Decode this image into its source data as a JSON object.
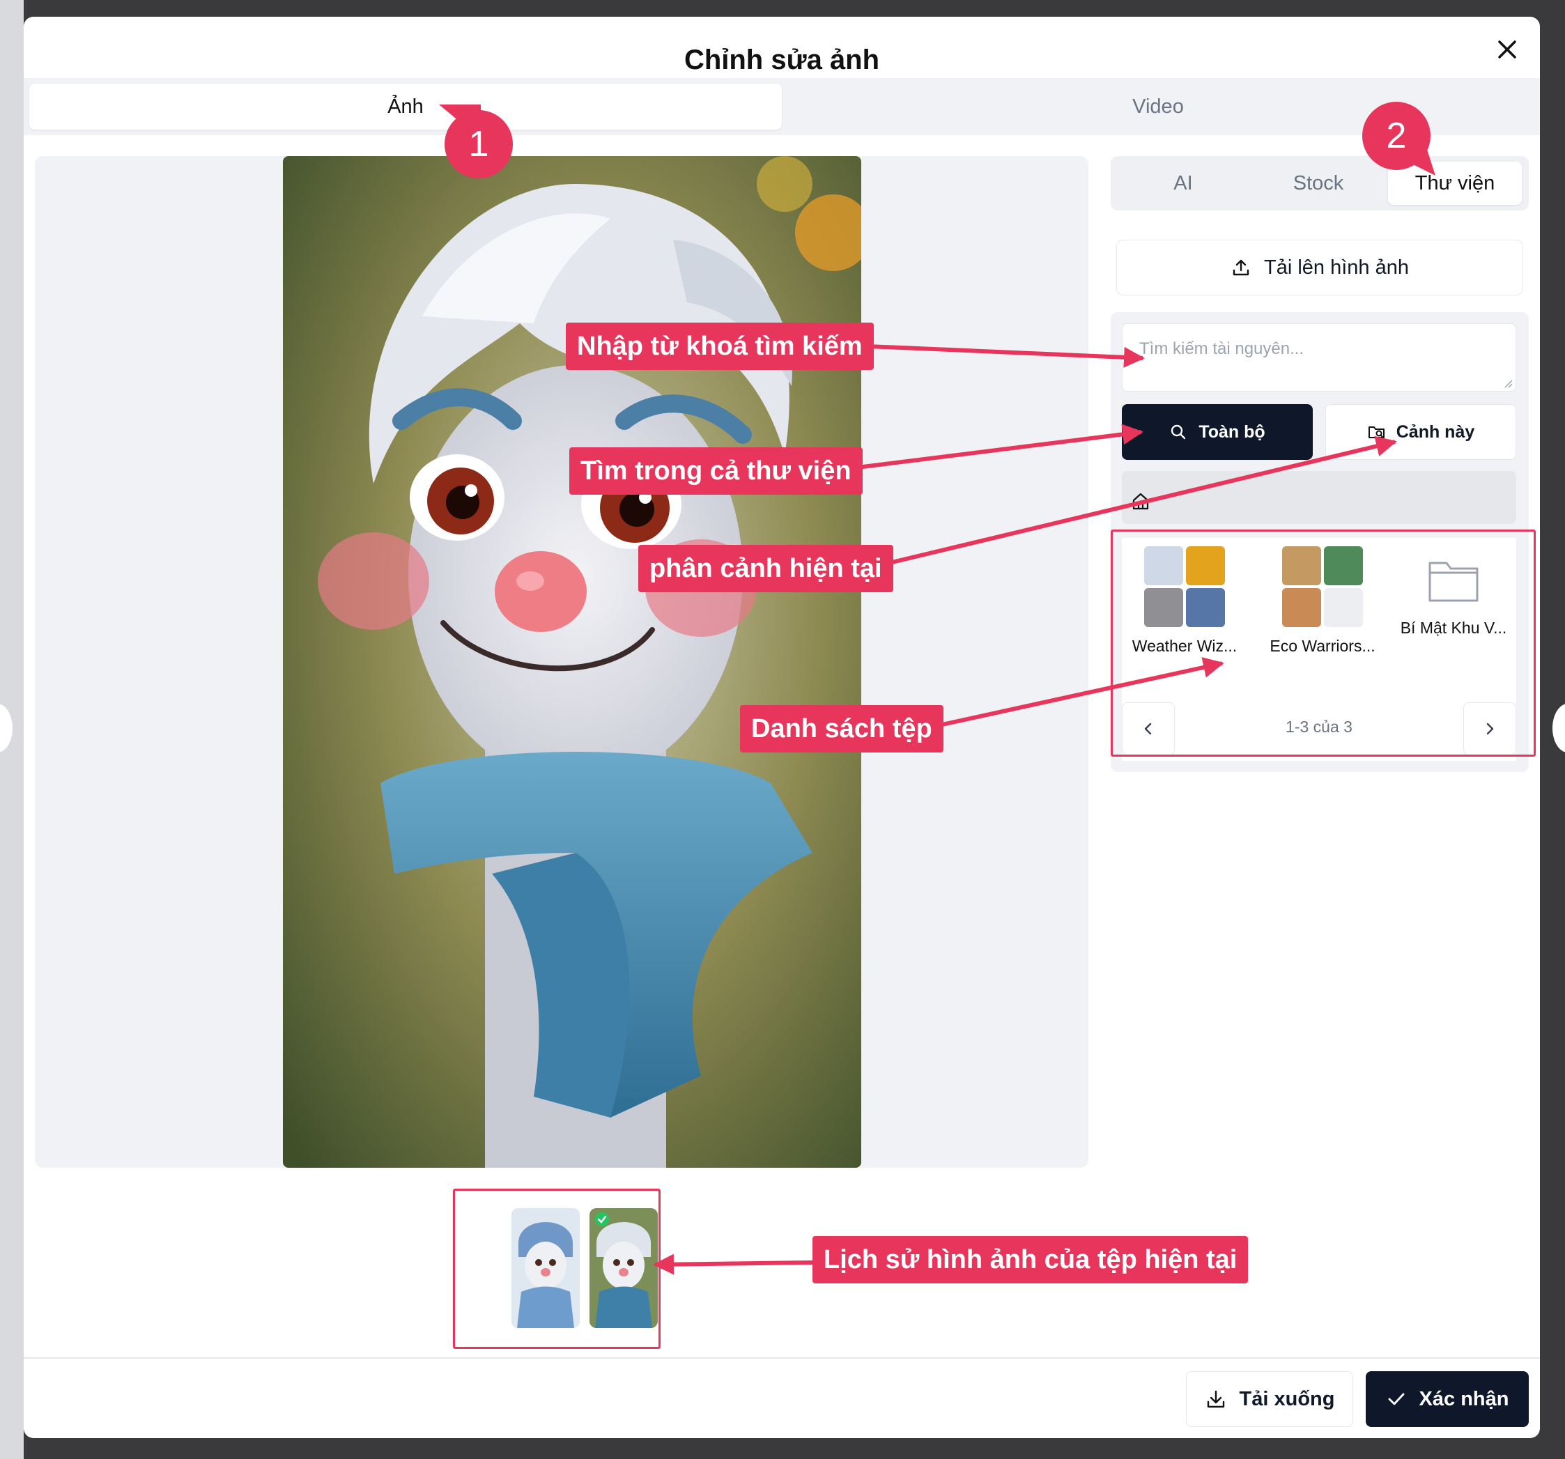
{
  "dialog": {
    "title": "Chỉnh sửa ảnh"
  },
  "main_tabs": [
    {
      "label": "Ảnh",
      "active": true
    },
    {
      "label": "Video",
      "active": false
    }
  ],
  "sub_tabs": [
    {
      "label": "AI",
      "active": false
    },
    {
      "label": "Stock",
      "active": false
    },
    {
      "label": "Thư viện",
      "active": true
    }
  ],
  "upload": {
    "label": "Tải lên hình ảnh"
  },
  "search": {
    "placeholder": "Tìm kiếm tài nguyên..."
  },
  "scope": {
    "all_label": "Toàn bộ",
    "scene_label": "Cảnh này"
  },
  "files": [
    {
      "name": "Weather Wiz...",
      "thumbs": [
        "#cfd8e6",
        "#e4a31c",
        "#8f8f94",
        "#5776a8"
      ]
    },
    {
      "name": "Eco Warriors...",
      "thumbs": [
        "#c49a62",
        "#4f8a5a",
        "#c98a55",
        "#eceef1"
      ]
    },
    {
      "name": "Bí Mật Khu V...",
      "thumbs": []
    }
  ],
  "pagination": {
    "text": "1-3 của 3"
  },
  "footer": {
    "download_label": "Tải xuống",
    "confirm_label": "Xác nhận"
  },
  "annotations": {
    "badge1": "1",
    "badge2": "2",
    "search_hint": "Nhập từ khoá tìm kiếm",
    "all_hint": "Tìm trong cả thư viện",
    "scene_hint": "phân cảnh hiện tại",
    "files_hint": "Danh sách tệp",
    "history_hint": "Lịch sử hình ảnh của tệp hiện tại"
  },
  "colors": {
    "accent": "#e8355b",
    "primary_button": "#0f172a"
  },
  "icons": [
    "close-icon",
    "upload-icon",
    "search-icon",
    "folder-search-icon",
    "home-icon",
    "folder-icon",
    "chevron-left-icon",
    "chevron-right-icon",
    "download-icon",
    "check-icon"
  ]
}
